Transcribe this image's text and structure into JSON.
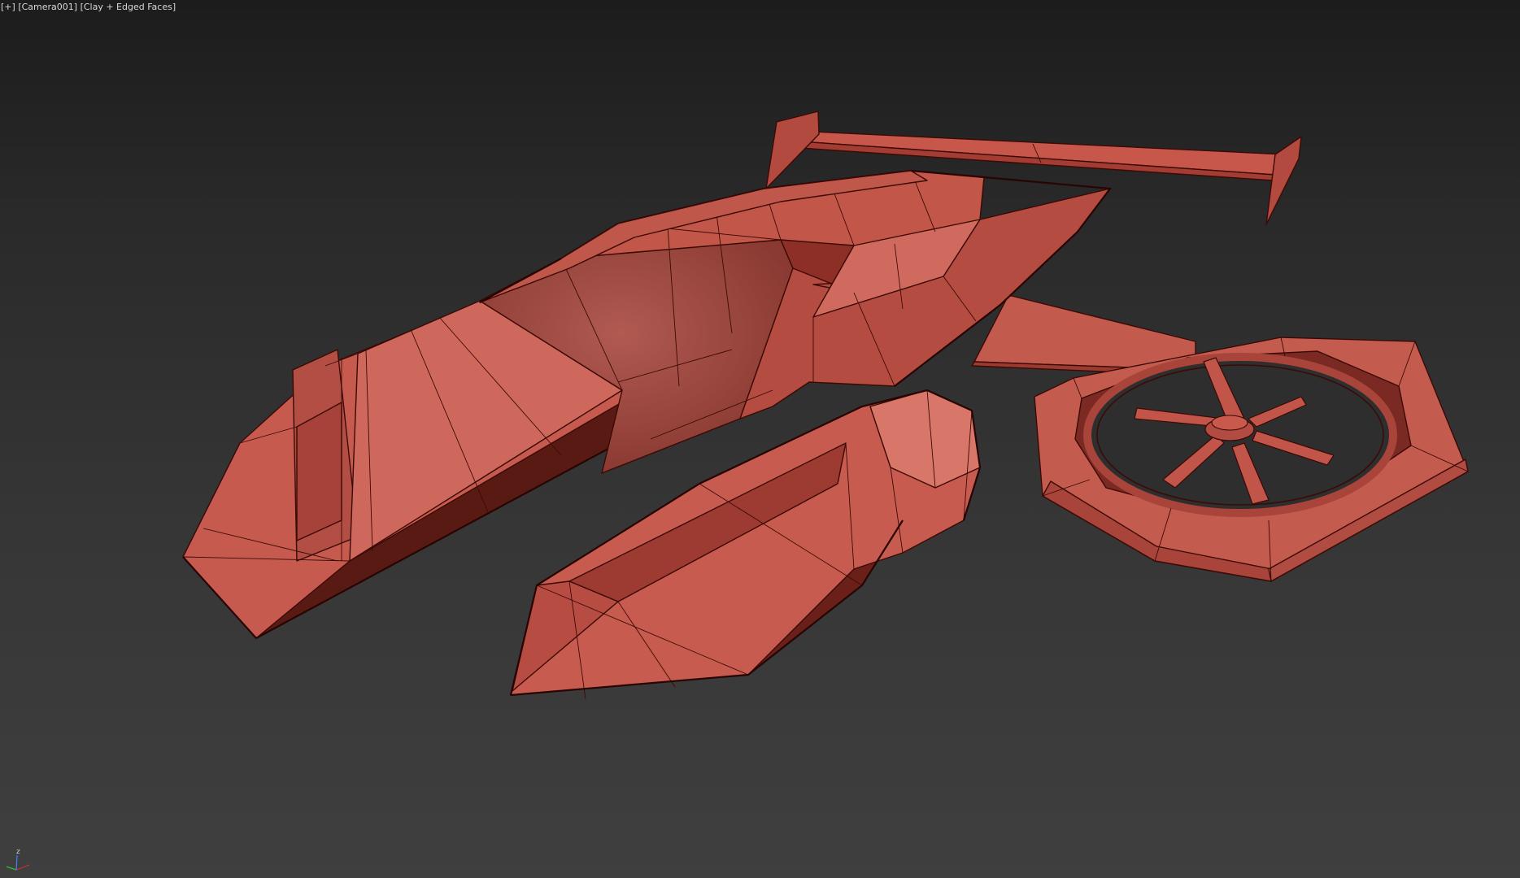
{
  "viewport": {
    "menu_label": "[+]",
    "camera_label": "[Camera001]",
    "shading_label": "[Clay + Edged Faces]"
  },
  "axis_gizmo": {
    "z_label": "z",
    "x_color": "#d03030",
    "y_color": "#30c030",
    "z_color": "#4080ff"
  },
  "colors": {
    "clay": "#c0554a",
    "clay_light": "#cf6a5e",
    "clay_dark": "#8e332b",
    "clay_shadow": "#5e1c16",
    "wire": "#3a0a05"
  }
}
